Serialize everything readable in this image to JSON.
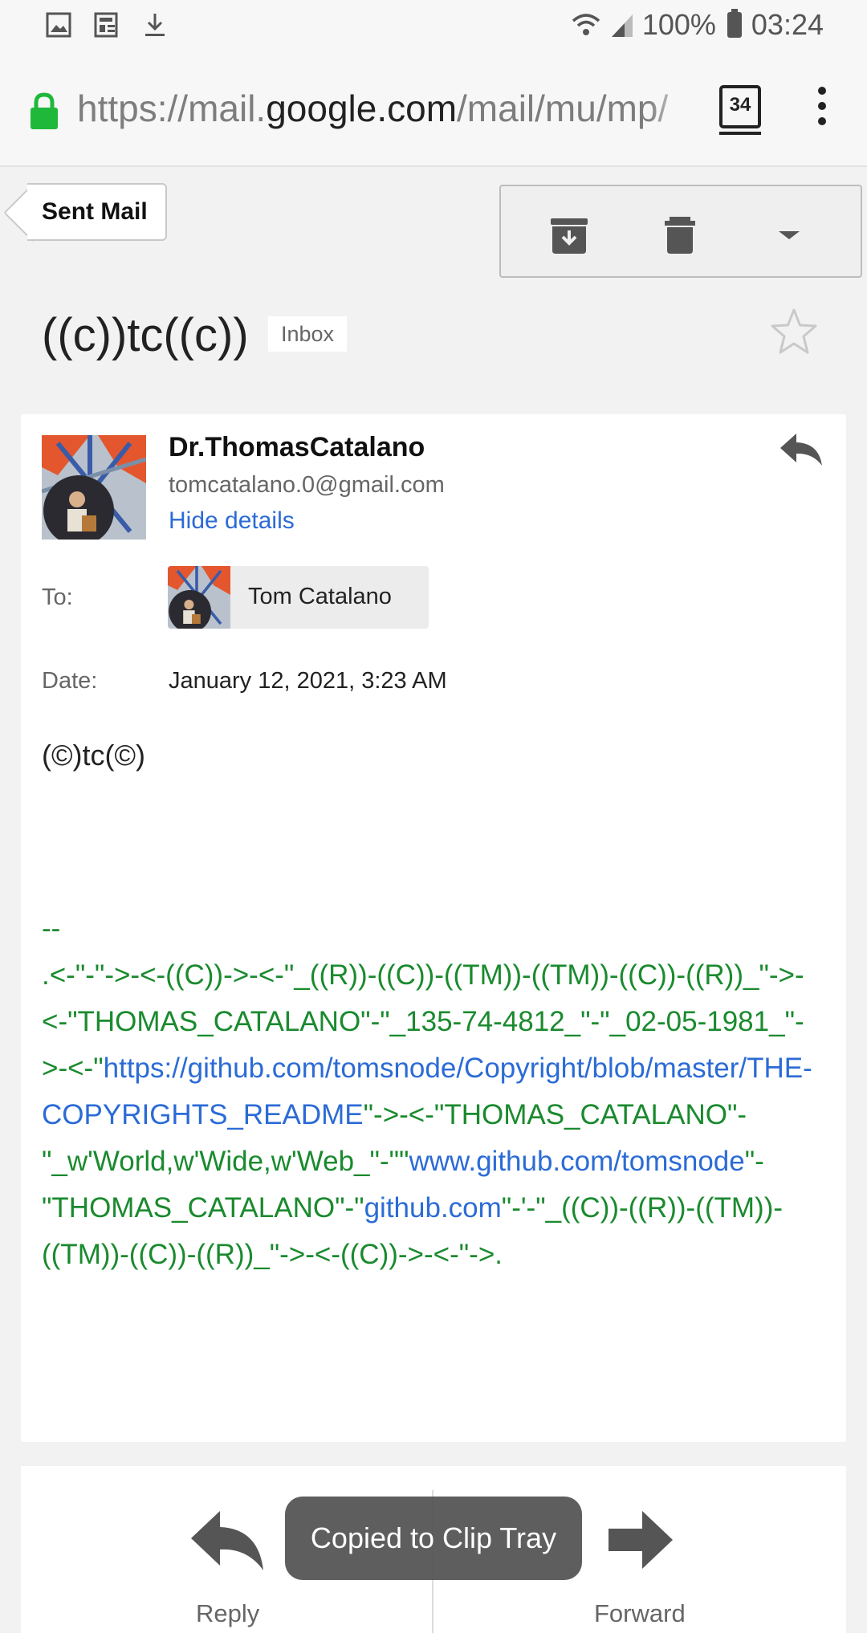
{
  "status_bar": {
    "battery": "100%",
    "time": "03:24"
  },
  "browser": {
    "url_prefix": "https://mail.",
    "url_domain": "google.com",
    "url_path": "/mail/mu/mp/",
    "tab_count": "34"
  },
  "nav": {
    "back_label": "Sent Mail"
  },
  "message": {
    "subject": "((c))tc((c))",
    "label": "Inbox",
    "sender_name": "Dr.ThomasCatalano",
    "sender_email": "tomcatalano.0@gmail.com",
    "hide_details": "Hide details",
    "to_label": "To:",
    "to_name": "Tom Catalano",
    "date_label": "Date:",
    "date_value": "January 12, 2021, 3:23 AM",
    "body": "(©)tc(©)"
  },
  "signature": {
    "dashes": "--",
    "part1": ".<-\"-\"->-<-((C))->-<-\"_((R))-((C))-((TM))-((TM))-((C))-((R))_\"->-<-\"THOMAS_CATALANO\"-\"_135-74-4812_\"-\"_02-05-1981_\"->-<-\"",
    "link1": "https://github.com/tomsnode/Copyright/blob/master/THE-COPYRIGHTS_README",
    "part2": "\"->-<-\"THOMAS_CATALANO\"-\"_w'World,w'Wide,w'Web_\"-\"\"",
    "link2": "www.github.com/tomsnode",
    "part3": "\"-\"THOMAS_CATALANO\"-\"",
    "link3": "github.com",
    "part4": "\"-'-\"_((C))-((R))-((TM))-((TM))-((C))-((R))_\"->-<-((C))->-<-\"->."
  },
  "bottom_actions": {
    "reply_label": "Reply",
    "forward_label": "Forward"
  },
  "toast": {
    "text": "Copied to Clip Tray"
  },
  "colors": {
    "link": "#2b6bd6",
    "signature": "#1a8a2e",
    "lock": "#1fb83a"
  }
}
